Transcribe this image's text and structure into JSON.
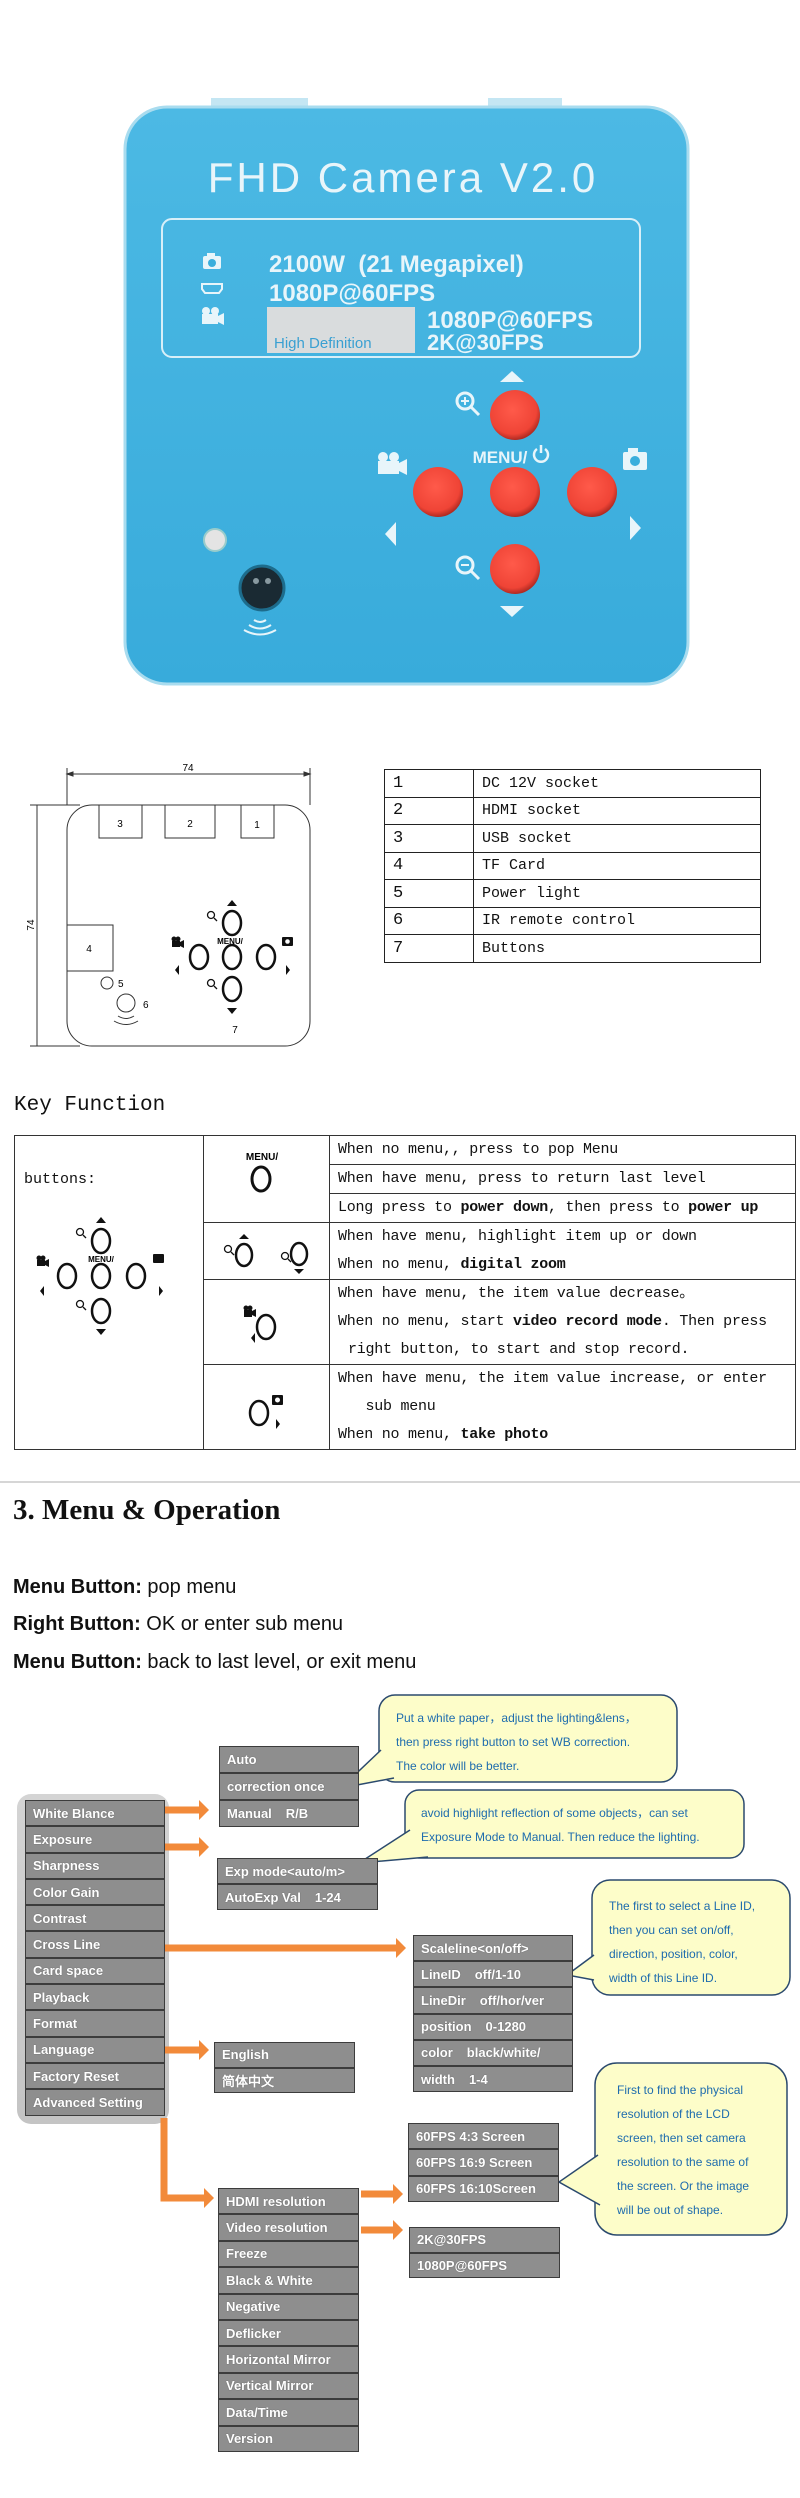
{
  "camera": {
    "title": "FHD Camera V2.0",
    "photo_spec": "2100W  (21 Megapixel)",
    "hdmi_spec": "1080P@60FPS",
    "high_definition": "High Definition",
    "video_spec_1": "1080P@60FPS",
    "video_spec_2": "2K@30FPS",
    "menu_label": "MENU/",
    "body_color": "#3aaedc",
    "button_color": "#f2493d"
  },
  "diagram": {
    "width_dim": "74",
    "height_dim": "74",
    "menu_label": "MENU/",
    "labels": {
      "p1": "1",
      "p2": "2",
      "p3": "3",
      "p4": "4",
      "p5": "5",
      "p6": "6",
      "p7": "7"
    }
  },
  "ports_table": {
    "rows": [
      {
        "num": "1",
        "desc": "DC 12V socket"
      },
      {
        "num": "2",
        "desc": "HDMI socket"
      },
      {
        "num": "3",
        "desc": "USB socket"
      },
      {
        "num": "4",
        "desc": "TF Card"
      },
      {
        "num": "5",
        "desc": "Power light"
      },
      {
        "num": "6",
        "desc": "IR remote control"
      },
      {
        "num": "7",
        "desc": "Buttons"
      }
    ]
  },
  "key_function": {
    "title": "Key Function",
    "buttons_label": "buttons:",
    "menu_label": "MENU/",
    "groups": [
      {
        "icon": "menu-power-button",
        "separated": true,
        "lines": [
          {
            "segs": [
              {
                "t": "When no menu,, press to pop Menu"
              }
            ]
          },
          {
            "segs": [
              {
                "t": "When have menu, press to return last level"
              }
            ]
          },
          {
            "segs": [
              {
                "t": "Long press to "
              },
              {
                "t": "power down",
                "b": true
              },
              {
                "t": ", then press to "
              },
              {
                "t": "power up",
                "b": true
              }
            ]
          }
        ]
      },
      {
        "icon": "zoom-up-down-buttons",
        "lines": [
          {
            "segs": [
              {
                "t": "When have menu, highlight item up or down"
              }
            ]
          },
          {
            "segs": [
              {
                "t": "When no menu, "
              },
              {
                "t": "digital zoom",
                "b": true
              }
            ]
          }
        ]
      },
      {
        "icon": "left-video-button",
        "lines": [
          {
            "segs": [
              {
                "t": "When have menu, the item value decrease。"
              }
            ]
          },
          {
            "segs": [
              {
                "t": "When no menu, start "
              },
              {
                "t": "video record mode",
                "b": true
              },
              {
                "t": ". Then press"
              }
            ]
          },
          {
            "indent": true,
            "segs": [
              {
                "t": "right button, to start and stop record."
              }
            ]
          }
        ]
      },
      {
        "icon": "right-photo-button",
        "lines": [
          {
            "segs": [
              {
                "t": "When have menu, the item value increase, or enter"
              }
            ]
          },
          {
            "indent": true,
            "segs": [
              {
                "t": "  sub menu"
              }
            ]
          },
          {
            "segs": [
              {
                "t": "When no menu, "
              },
              {
                "t": "take photo",
                "b": true
              }
            ]
          }
        ]
      }
    ]
  },
  "section3": {
    "heading": "3. Menu & Operation",
    "instructions": [
      {
        "label": "Menu Button:",
        "text": " pop menu"
      },
      {
        "label": "Right Button:",
        "text": " OK or enter sub menu"
      },
      {
        "label": "Menu Button:",
        "text": " back to last level, or exit menu"
      }
    ]
  },
  "menu_tree": {
    "main": [
      {
        "label": "White Blance"
      },
      {
        "label": "Exposure"
      },
      {
        "label": "Sharpness"
      },
      {
        "label": "Color Gain"
      },
      {
        "label": "Contrast"
      },
      {
        "label": "Cross Line"
      },
      {
        "label": "Card space"
      },
      {
        "label": "Playback"
      },
      {
        "label": "Format"
      },
      {
        "label": "Language"
      },
      {
        "label": "Factory Reset"
      },
      {
        "label": "Advanced Setting"
      }
    ],
    "white_balance": [
      {
        "label": "Auto"
      },
      {
        "label": "correction once"
      },
      {
        "label": "Manual",
        "value": "R/B"
      }
    ],
    "exposure": [
      {
        "label": "Exp mode<auto/m>"
      },
      {
        "label": "AutoExp Val",
        "value": "1-24"
      }
    ],
    "cross_line": [
      {
        "label": "Scaleline<on/off>"
      },
      {
        "label": "LineID",
        "value": "off/1-10"
      },
      {
        "label": "LineDir",
        "value": "off/hor/ver"
      },
      {
        "label": "position",
        "value": "0-1280"
      },
      {
        "label": "color",
        "value": "black/white/"
      },
      {
        "label": "width",
        "value": "1-4"
      }
    ],
    "language": [
      {
        "label": "English"
      },
      {
        "label": "简体中文"
      }
    ],
    "advanced": [
      {
        "label": "HDMI resolution"
      },
      {
        "label": "Video resolution"
      },
      {
        "label": "Freeze"
      },
      {
        "label": "Black & White"
      },
      {
        "label": "Negative"
      },
      {
        "label": "Deflicker"
      },
      {
        "label": "Horizontal Mirror"
      },
      {
        "label": "Vertical Mirror"
      },
      {
        "label": "Data/Time"
      },
      {
        "label": "Version"
      }
    ],
    "hdmi_resolution": [
      {
        "label": "60FPS 4:3 Screen"
      },
      {
        "label": "60FPS 16:9 Screen"
      },
      {
        "label": "60FPS 16:10Screen"
      }
    ],
    "video_resolution": [
      {
        "label": "2K@30FPS"
      },
      {
        "label": "1080P@60FPS"
      }
    ],
    "tips": {
      "white_balance": [
        "Put a white paper，adjust the lighting&lens，",
        "then press right button to set WB correction.",
        "The color will be better."
      ],
      "exposure": [
        "avoid highlight reflection of some objects，can set",
        "Exposure Mode to Manual. Then reduce the lighting."
      ],
      "cross_line": [
        "The first to select a Line ID,",
        "then you can set on/off,",
        "direction, position, color,",
        "width of this Line ID."
      ],
      "hdmi": [
        "First to find the physical",
        "resolution of the LCD",
        "screen, then set camera",
        "resolution to the same of",
        "the screen. Or the image",
        "will be out of shape."
      ]
    },
    "colors": {
      "arrow": "#f28a3a",
      "menu_item": "#8e8e8e",
      "tip_fill": "#fdfdc9",
      "tip_border": "#2b4a6e",
      "tip_text": "#1e6cae"
    }
  }
}
